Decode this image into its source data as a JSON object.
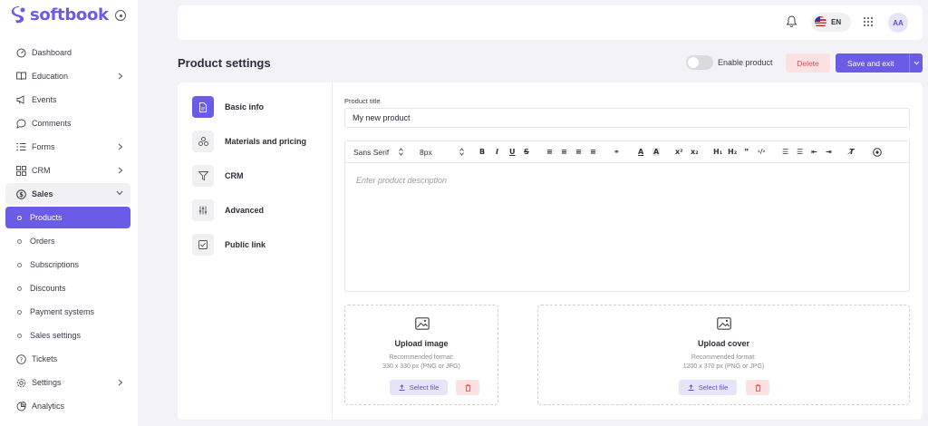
{
  "app": {
    "brand": "softbook"
  },
  "colors": {
    "accent": "#6b5ce7",
    "danger": "#d9534f",
    "danger_bg": "#fbe1e1"
  },
  "sidebar": {
    "items": [
      {
        "label": "Dashboard",
        "icon": "dashboard-icon"
      },
      {
        "label": "Education",
        "icon": "book-icon",
        "chevron": true
      },
      {
        "label": "Events",
        "icon": "megaphone-icon"
      },
      {
        "label": "Comments",
        "icon": "comment-icon"
      },
      {
        "label": "Forms",
        "icon": "list-icon",
        "chevron": true
      },
      {
        "label": "CRM",
        "icon": "grid-icon",
        "chevron": true
      },
      {
        "label": "Sales",
        "icon": "dollar-icon",
        "expanded": true
      }
    ],
    "sales_sub": [
      {
        "label": "Products",
        "active": true
      },
      {
        "label": "Orders"
      },
      {
        "label": "Subscriptions"
      },
      {
        "label": "Discounts"
      },
      {
        "label": "Payment systems"
      },
      {
        "label": "Sales settings"
      }
    ],
    "bottom_items": [
      {
        "label": "Tickets",
        "icon": "help-icon"
      },
      {
        "label": "Settings",
        "icon": "gear-icon",
        "chevron": true
      },
      {
        "label": "Analytics",
        "icon": "analytics-icon"
      }
    ]
  },
  "header": {
    "language": "EN",
    "avatar_initials": "AA"
  },
  "page": {
    "title": "Product settings",
    "enable_label": "Enable product",
    "enabled": false,
    "delete_label": "Delete",
    "save_label": "Save and exit"
  },
  "tabs": [
    {
      "label": "Basic info",
      "icon": "document-icon",
      "active": true
    },
    {
      "label": "Materials and pricing",
      "icon": "shapes-icon"
    },
    {
      "label": "CRM",
      "icon": "funnel-icon"
    },
    {
      "label": "Advanced",
      "icon": "sliders-icon"
    },
    {
      "label": "Public link",
      "icon": "checkbox-icon"
    }
  ],
  "form": {
    "title_label": "Product title",
    "title_value": "My new product",
    "font_family": "Sans Serif",
    "font_size": "8px",
    "description_placeholder": "Enter product description"
  },
  "upload_image": {
    "title": "Upload image",
    "hint_line1": "Recommended format:",
    "hint_line2": "330 x 330 px (PNG or JPG)",
    "select_label": "Select file"
  },
  "upload_cover": {
    "title": "Upload cover",
    "hint_line1": "Recommended format:",
    "hint_line2": "1200 x 370 px (PNG or JPG)",
    "select_label": "Select file"
  }
}
